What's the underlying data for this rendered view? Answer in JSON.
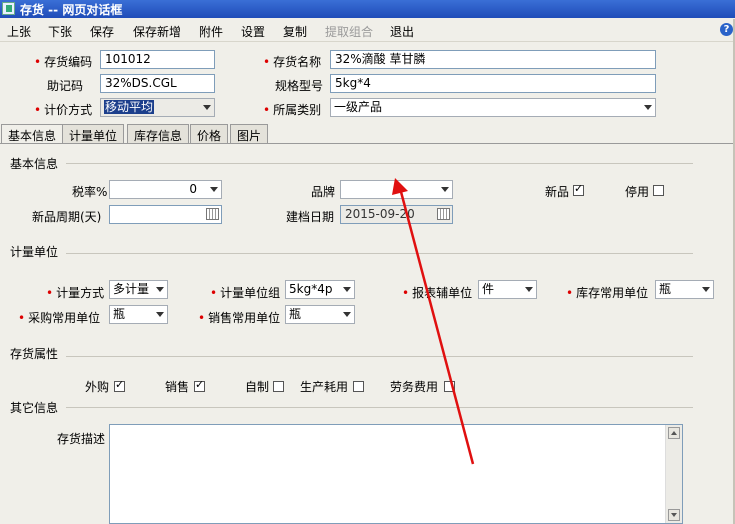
{
  "window": {
    "title": "存货 -- 网页对话框"
  },
  "menu": {
    "items": [
      "上张",
      "下张",
      "保存",
      "保存新增",
      "附件",
      "设置",
      "复制",
      "提取组合",
      "退出"
    ],
    "help": "?"
  },
  "header_fields": {
    "code_label": "存货编码",
    "code_value": "101012",
    "name_label": "存货名称",
    "name_value": "32%滴酸 草甘膦",
    "mnemonic_label": "助记码",
    "mnemonic_value": "32%DS.CGL",
    "spec_label": "规格型号",
    "spec_value": "5kg*4",
    "pricing_label": "计价方式",
    "pricing_value": "移动平均",
    "category_label": "所属类别",
    "category_value": "一级产品"
  },
  "tabs": [
    "基本信息",
    "计量单位",
    "库存信息",
    "价格",
    "图片"
  ],
  "basic": {
    "section": "基本信息",
    "tax_label": "税率%",
    "tax_value": "0",
    "brand_label": "品牌",
    "brand_value": "",
    "new_label": "新品",
    "new_checked": true,
    "disable_label": "停用",
    "disable_checked": false,
    "cycle_label": "新品周期(天)",
    "cycle_value": "",
    "created_label": "建档日期",
    "created_value": "2015-09-20"
  },
  "units": {
    "section": "计量单位",
    "method_label": "计量方式",
    "method_value": "多计量",
    "group_label": "计量单位组",
    "group_value": "5kg*4p",
    "report_label": "报表辅单位",
    "report_value": "件",
    "stock_label": "库存常用单位",
    "stock_value": "瓶",
    "purchase_label": "采购常用单位",
    "purchase_value": "瓶",
    "sales_label": "销售常用单位",
    "sales_value": "瓶"
  },
  "attributes": {
    "section": "存货属性",
    "items": [
      {
        "label": "外购",
        "checked": true
      },
      {
        "label": "销售",
        "checked": true
      },
      {
        "label": "自制",
        "checked": false
      },
      {
        "label": "生产耗用",
        "checked": false
      },
      {
        "label": "劳务费用",
        "checked": false
      }
    ]
  },
  "other": {
    "section": "其它信息",
    "desc_label": "存货描述",
    "desc_value": ""
  },
  "colors": {
    "title_bar": "#2456c4",
    "required": "#dd0000",
    "arrow": "#e01010"
  }
}
